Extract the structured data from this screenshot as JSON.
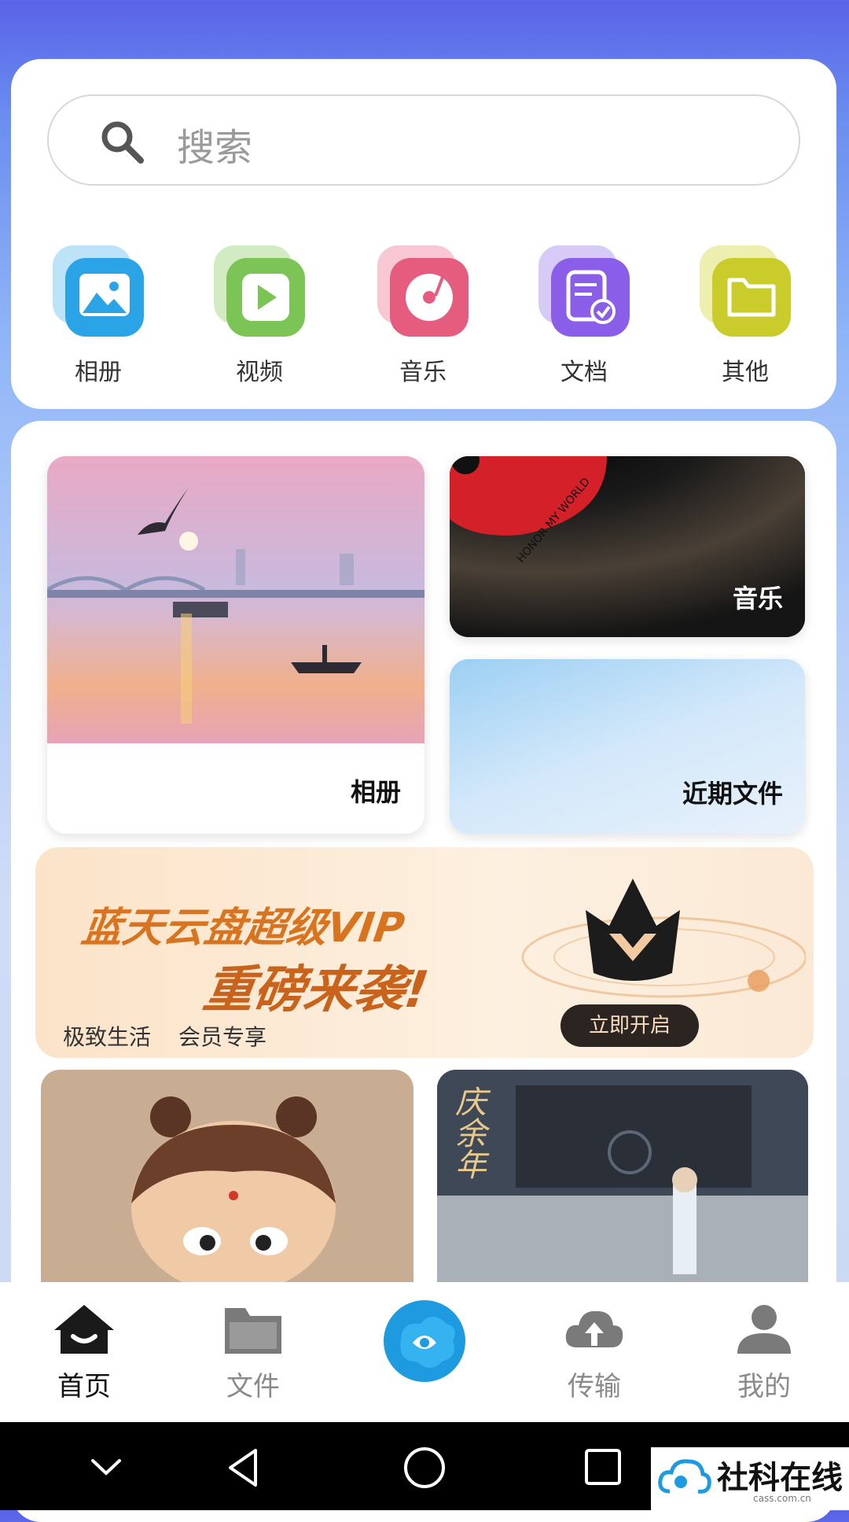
{
  "search": {
    "placeholder": "搜索"
  },
  "categories": [
    {
      "label": "相册",
      "icon": "photo-album-icon",
      "color": "#2aa4e6"
    },
    {
      "label": "视频",
      "icon": "video-play-icon",
      "color": "#7cc455"
    },
    {
      "label": "音乐",
      "icon": "music-disc-icon",
      "color": "#e65c7e"
    },
    {
      "label": "文档",
      "icon": "document-icon",
      "color": "#8a5ee8"
    },
    {
      "label": "其他",
      "icon": "folder-icon",
      "color": "#c9cc2a"
    }
  ],
  "tiles": {
    "album": "相册",
    "music": "音乐",
    "recent": "近期文件"
  },
  "music_record_text": "HONOR MY WORLD",
  "banner": {
    "headline_1": "蓝天云盘超级VIP",
    "headline_2": "重磅来袭!",
    "tagline_1": "极致生活",
    "tagline_2": "会员专享",
    "cta": "立即开启"
  },
  "poster_title": "庆余年",
  "nav": [
    {
      "label": "首页",
      "icon": "home-icon",
      "active": true
    },
    {
      "label": "文件",
      "icon": "folder-icon",
      "active": false
    },
    {
      "label": "",
      "icon": "cloud-logo-icon",
      "active": false
    },
    {
      "label": "传输",
      "icon": "upload-cloud-icon",
      "active": false
    },
    {
      "label": "我的",
      "icon": "user-icon",
      "active": false
    }
  ],
  "watermark": {
    "brand": "社科在线",
    "url": "cass.com.cn"
  }
}
